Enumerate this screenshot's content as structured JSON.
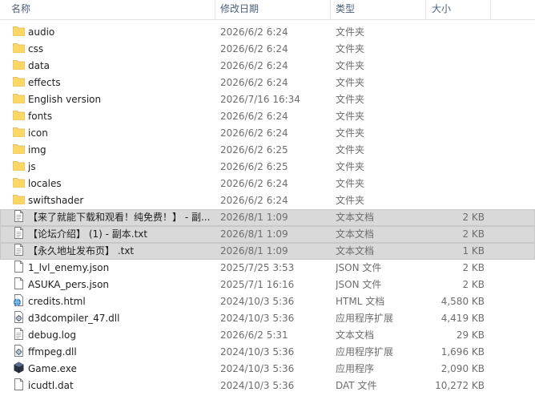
{
  "columns": {
    "name": "名称",
    "date": "修改日期",
    "type": "类型",
    "size": "大小"
  },
  "rows": [
    {
      "name": "audio",
      "date": "2026/6/2 6:24",
      "type": "文件夹",
      "size": "",
      "icon": "folder-icon",
      "selected": false
    },
    {
      "name": "css",
      "date": "2026/6/2 6:24",
      "type": "文件夹",
      "size": "",
      "icon": "folder-icon",
      "selected": false
    },
    {
      "name": "data",
      "date": "2026/6/2 6:24",
      "type": "文件夹",
      "size": "",
      "icon": "folder-icon",
      "selected": false
    },
    {
      "name": "effects",
      "date": "2026/6/2 6:24",
      "type": "文件夹",
      "size": "",
      "icon": "folder-icon",
      "selected": false
    },
    {
      "name": "English version",
      "date": "2026/7/16 16:34",
      "type": "文件夹",
      "size": "",
      "icon": "folder-icon",
      "selected": false
    },
    {
      "name": "fonts",
      "date": "2026/6/2 6:24",
      "type": "文件夹",
      "size": "",
      "icon": "folder-icon",
      "selected": false
    },
    {
      "name": "icon",
      "date": "2026/6/2 6:24",
      "type": "文件夹",
      "size": "",
      "icon": "folder-icon",
      "selected": false
    },
    {
      "name": "img",
      "date": "2026/6/2 6:25",
      "type": "文件夹",
      "size": "",
      "icon": "folder-icon",
      "selected": false
    },
    {
      "name": "js",
      "date": "2026/6/2 6:25",
      "type": "文件夹",
      "size": "",
      "icon": "folder-icon",
      "selected": false
    },
    {
      "name": "locales",
      "date": "2026/6/2 6:24",
      "type": "文件夹",
      "size": "",
      "icon": "folder-icon",
      "selected": false
    },
    {
      "name": "swiftshader",
      "date": "2026/6/2 6:24",
      "type": "文件夹",
      "size": "",
      "icon": "folder-icon",
      "selected": false
    },
    {
      "name": "【来了就能下载和观看！纯免费！】 - 副...",
      "date": "2026/8/1 1:09",
      "type": "文本文档",
      "size": "2 KB",
      "icon": "text-file-icon",
      "selected": true
    },
    {
      "name": "【论坛介绍】 (1) - 副本.txt",
      "date": "2026/8/1 1:09",
      "type": "文本文档",
      "size": "2 KB",
      "icon": "text-file-icon",
      "selected": true
    },
    {
      "name": "【永久地址发布页】 .txt",
      "date": "2026/8/1 1:09",
      "type": "文本文档",
      "size": "1 KB",
      "icon": "text-file-icon",
      "selected": true
    },
    {
      "name": "1_lvl_enemy.json",
      "date": "2025/7/25 3:53",
      "type": "JSON 文件",
      "size": "2 KB",
      "icon": "file-icon",
      "selected": false
    },
    {
      "name": "ASUKA_pers.json",
      "date": "2025/7/1 16:16",
      "type": "JSON 文件",
      "size": "2 KB",
      "icon": "file-icon",
      "selected": false
    },
    {
      "name": "credits.html",
      "date": "2024/10/3 5:36",
      "type": "HTML 文档",
      "size": "4,580 KB",
      "icon": "html-file-icon",
      "selected": false
    },
    {
      "name": "d3dcompiler_47.dll",
      "date": "2024/10/3 5:36",
      "type": "应用程序扩展",
      "size": "4,419 KB",
      "icon": "dll-file-icon",
      "selected": false
    },
    {
      "name": "debug.log",
      "date": "2026/6/2 5:31",
      "type": "文本文档",
      "size": "29 KB",
      "icon": "text-file-icon",
      "selected": false
    },
    {
      "name": "ffmpeg.dll",
      "date": "2024/10/3 5:36",
      "type": "应用程序扩展",
      "size": "1,696 KB",
      "icon": "dll-file-icon",
      "selected": false
    },
    {
      "name": "Game.exe",
      "date": "2024/10/3 5:36",
      "type": "应用程序",
      "size": "2,090 KB",
      "icon": "game-exe-icon",
      "selected": false
    },
    {
      "name": "icudtl.dat",
      "date": "2024/10/3 5:36",
      "type": "DAT 文件",
      "size": "10,272 KB",
      "icon": "file-icon",
      "selected": false
    }
  ]
}
